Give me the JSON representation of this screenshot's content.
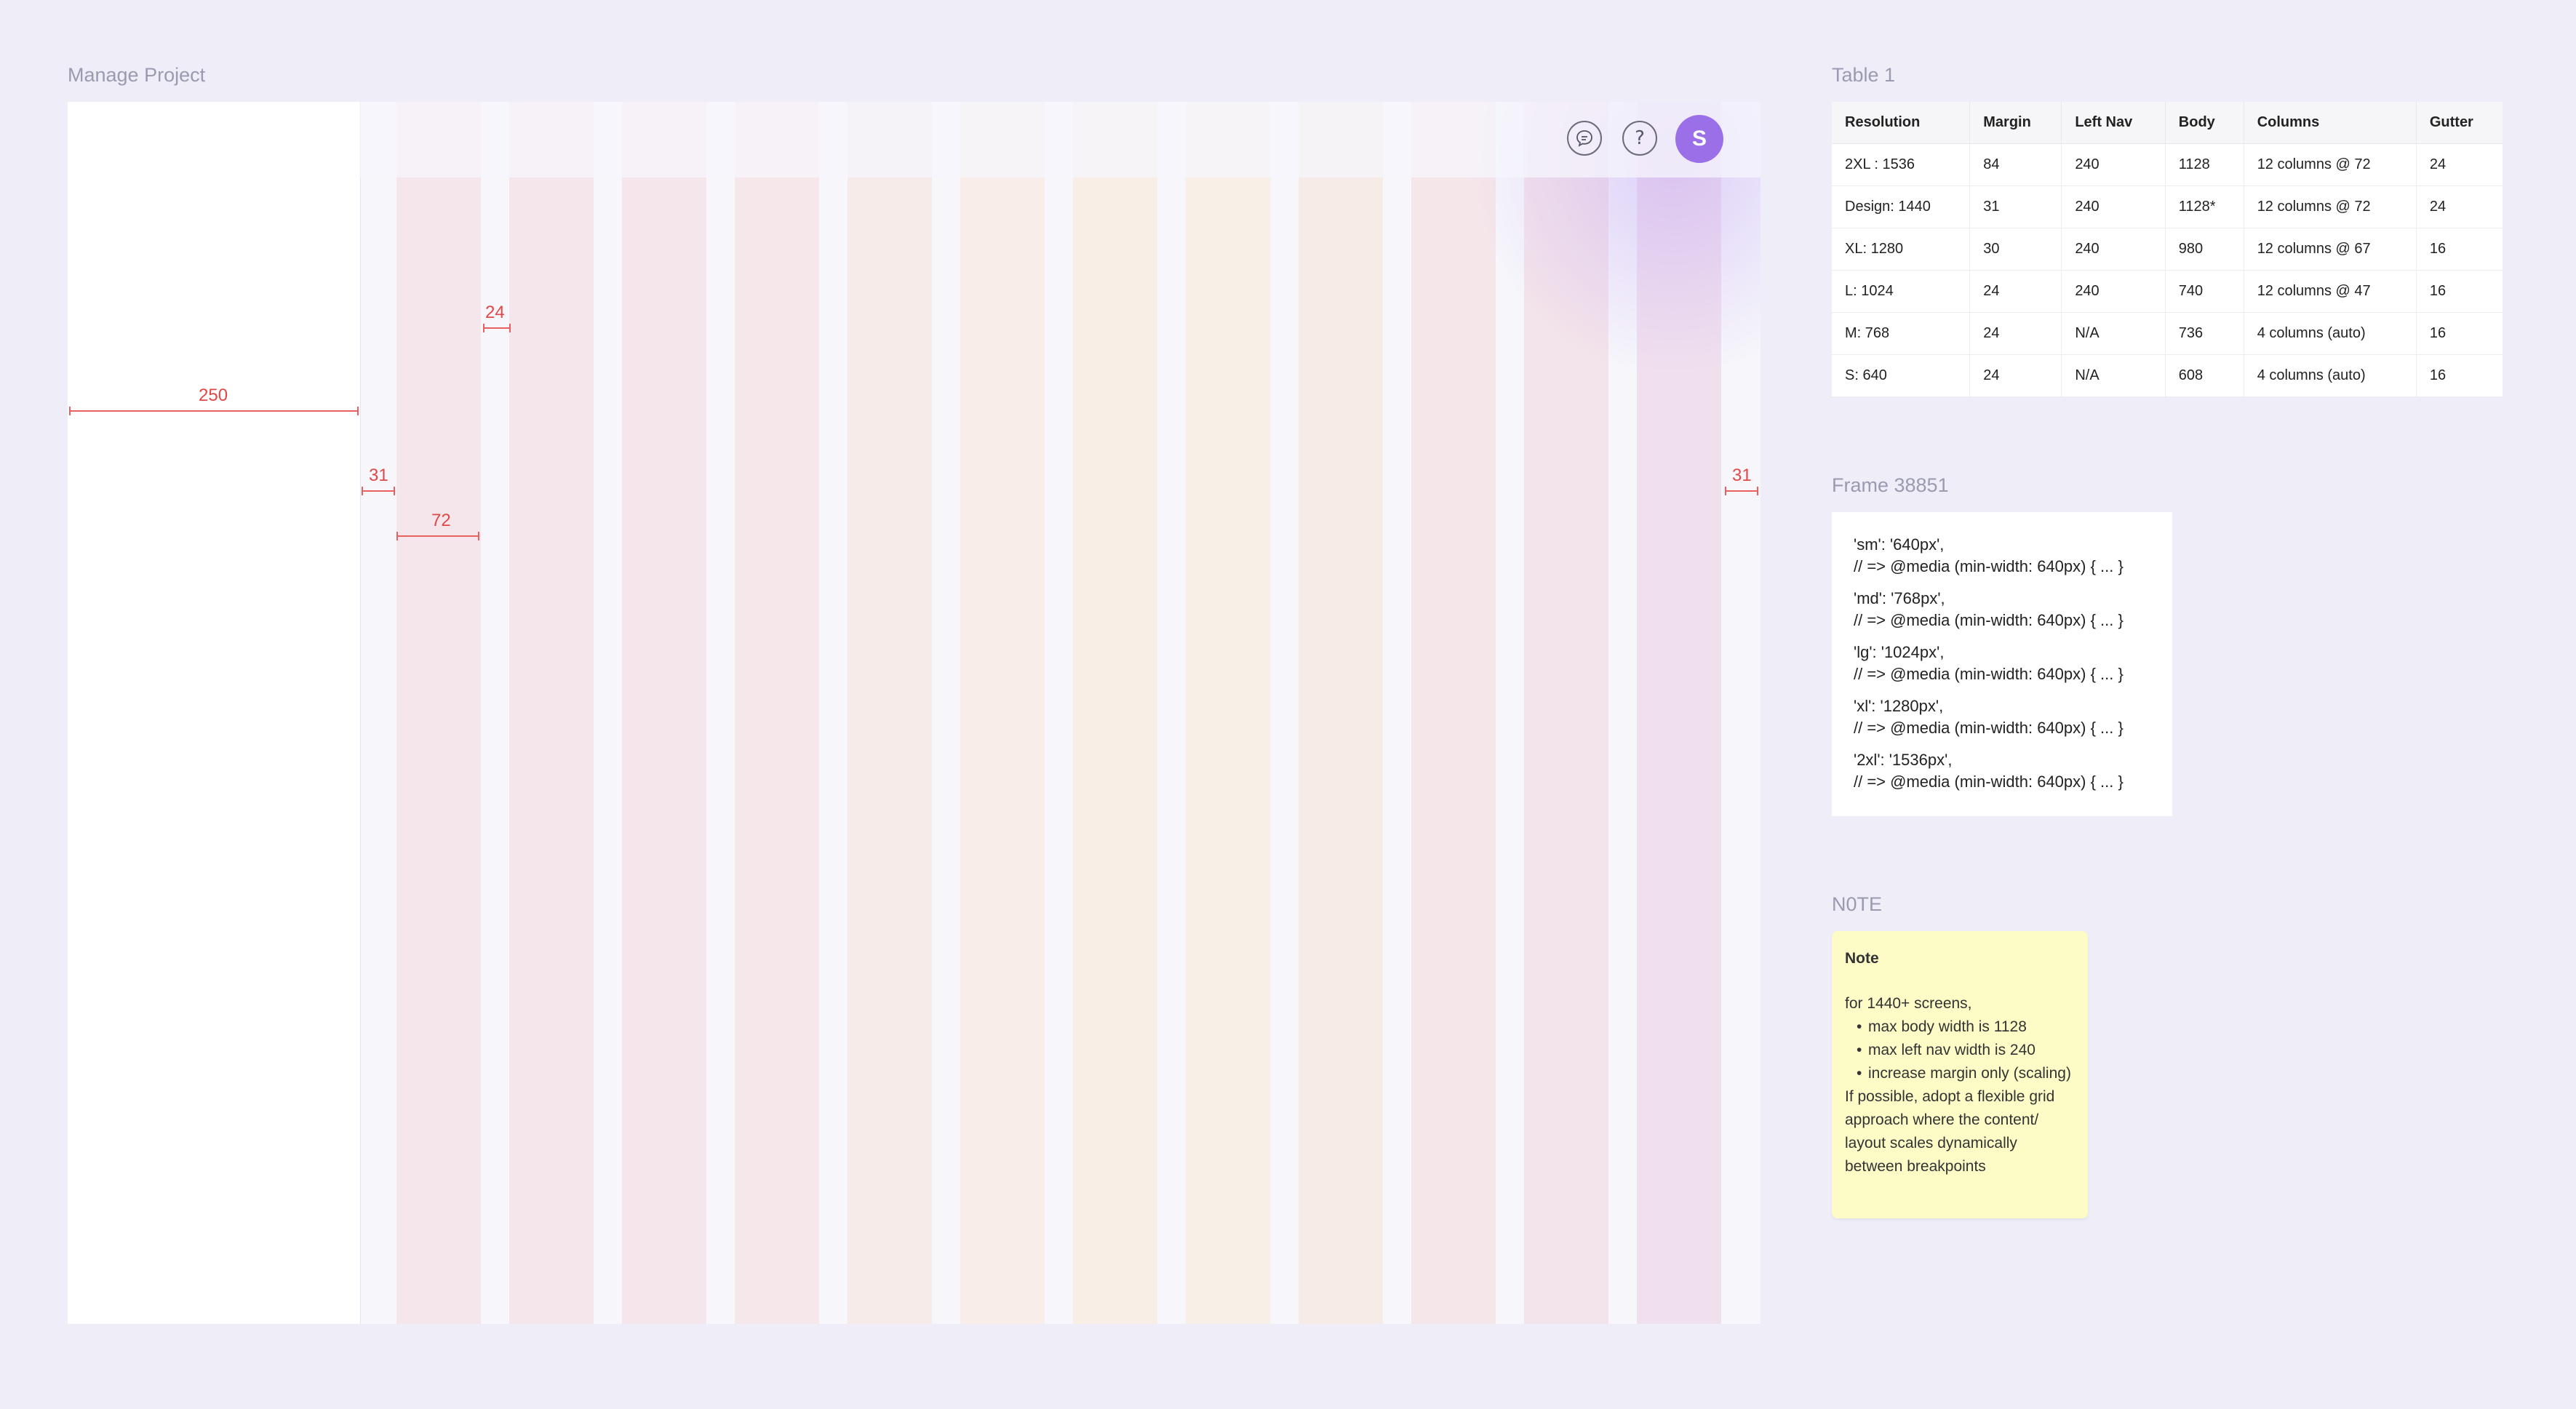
{
  "labels": {
    "manage_project": "Manage Project",
    "table": "Table 1",
    "frame": "Frame 38851",
    "note_frame": "N0TE"
  },
  "header": {
    "avatar_initial": "S",
    "chat_icon": "chat-bubble-icon",
    "help_icon": "question-icon",
    "help_glyph": "?"
  },
  "dimensions": {
    "left_nav": "250",
    "gutter": "24",
    "margin_left": "31",
    "column": "72",
    "margin_right": "31"
  },
  "colors": {
    "annotation": "#e04848",
    "avatar": "#9b6fe8",
    "note_bg": "#fdfcc7"
  },
  "table": {
    "headers": [
      "Resolution",
      "Margin",
      "Left Nav",
      "Body",
      "Columns",
      "Gutter"
    ],
    "rows": [
      [
        "2XL : 1536",
        "84",
        "240",
        "1128",
        "12 columns @ 72",
        "24"
      ],
      [
        "Design: 1440",
        "31",
        "240",
        "1128*",
        "12 columns @ 72",
        "24"
      ],
      [
        "XL: 1280",
        "30",
        "240",
        "980",
        "12 columns @ 67",
        "16"
      ],
      [
        "L: 1024",
        "24",
        "240",
        "740",
        "12 columns @ 47",
        "16"
      ],
      [
        "M: 768",
        "24",
        "N/A",
        "736",
        "4 columns (auto)",
        "16"
      ],
      [
        "S: 640",
        "24",
        "N/A",
        "608",
        "4 columns (auto)",
        "16"
      ]
    ]
  },
  "breakpoints": [
    {
      "key": "'sm': '640px',",
      "media": "// => @media (min-width: 640px) { ... }"
    },
    {
      "key": "'md': '768px',",
      "media": "// => @media (min-width: 640px) { ... }"
    },
    {
      "key": "'lg': '1024px',",
      "media": "// => @media (min-width: 640px) { ... }"
    },
    {
      "key": "'xl': '1280px',",
      "media": "// => @media (min-width: 640px) { ... }"
    },
    {
      "key": "'2xl': '1536px',",
      "media": "// => @media (min-width: 640px) { ... }"
    }
  ],
  "note": {
    "title": "Note",
    "intro": "for 1440+ screens,",
    "bullets": [
      "max body width is 1128",
      "max left nav width is 240",
      "increase margin only (scaling)"
    ],
    "footer": "If possible, adopt a flexible grid approach where the content/ layout scales dynamically between breakpoints"
  }
}
